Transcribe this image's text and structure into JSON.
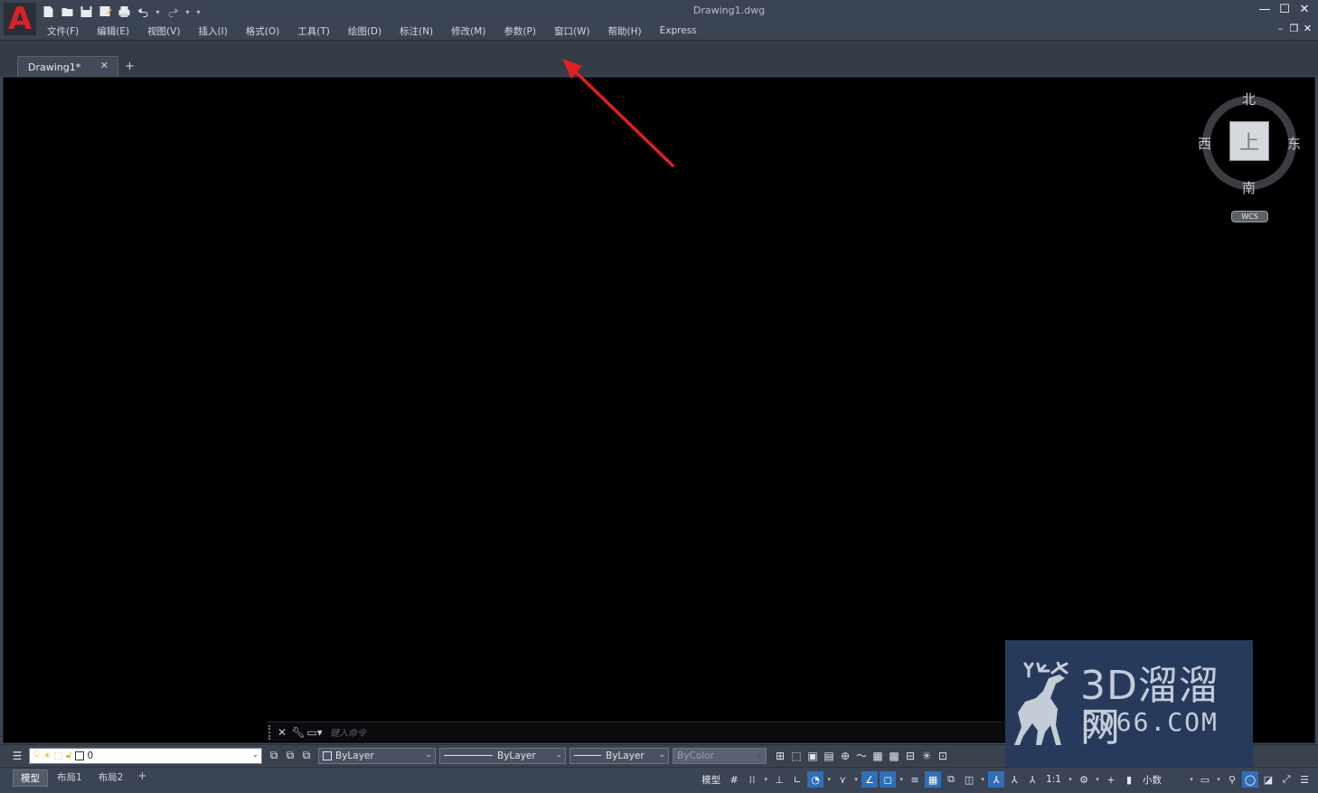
{
  "app": {
    "logo_letter": "A",
    "window_title": "Drawing1.dwg"
  },
  "quick_access": {
    "icons": [
      "new-icon",
      "open-icon",
      "save-icon",
      "save-as-icon",
      "print-icon",
      "undo-icon",
      "redo-icon",
      "customize-icon"
    ]
  },
  "menu": {
    "items": [
      "文件(F)",
      "编辑(E)",
      "视图(V)",
      "插入(I)",
      "格式(O)",
      "工具(T)",
      "绘图(D)",
      "标注(N)",
      "修改(M)",
      "参数(P)",
      "窗口(W)",
      "帮助(H)",
      "Express"
    ]
  },
  "tabs": {
    "active_label": "Drawing1*",
    "close_glyph": "✕",
    "add_glyph": "+"
  },
  "viewcube": {
    "north": "北",
    "south": "南",
    "west": "西",
    "east": "东",
    "face": "上",
    "wcs": "WCS"
  },
  "command_line": {
    "placeholder": "键入命令"
  },
  "properties": {
    "layer_name": "0",
    "color": "ByLayer",
    "linetype": "ByLayer",
    "lineweight": "ByLayer",
    "plotstyle": "ByColor"
  },
  "layouts": {
    "tabs": [
      "模型",
      "布局1",
      "布局2"
    ],
    "active": "模型",
    "add_glyph": "+"
  },
  "status": {
    "model_label": "模型",
    "scale": "1:1",
    "units": "小数"
  },
  "watermark": {
    "title": "3D溜溜网",
    "subtitle": "3D66.COM"
  },
  "colors": {
    "accent": "#2f6fb8",
    "logo_red": "#d8212c",
    "arrow_red": "#e02020",
    "canvas": "#000000",
    "chrome": "#3b4453"
  }
}
